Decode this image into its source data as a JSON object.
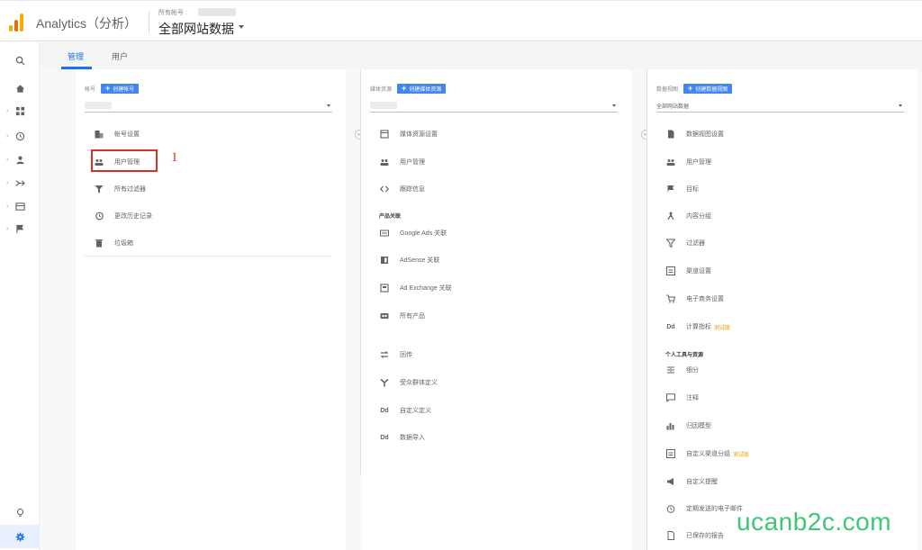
{
  "header": {
    "app_title": "Analytics（分析）",
    "account_label": "所有帐号 :",
    "account_value": "全部网站数据",
    "logo_colors": [
      "#f9ab00",
      "#e37400",
      "#f9ab00"
    ]
  },
  "tabs": [
    {
      "label": "管理",
      "active": true
    },
    {
      "label": "用户",
      "active": false
    }
  ],
  "columns": {
    "account": {
      "label": "帐号",
      "create_label": "创建帐号",
      "items": [
        {
          "icon": "building-icon",
          "label": "帐号设置"
        },
        {
          "icon": "users-icon",
          "label": "用户管理"
        },
        {
          "icon": "filter-icon",
          "label": "所有过滤器"
        },
        {
          "icon": "history-icon",
          "label": "更改历史记录"
        },
        {
          "icon": "trash-icon",
          "label": "垃圾箱"
        }
      ]
    },
    "property": {
      "label": "媒体资源",
      "create_label": "创建媒体资源",
      "items": [
        {
          "icon": "property-settings-icon",
          "label": "媒体资源设置"
        },
        {
          "icon": "users-icon",
          "label": "用户管理"
        },
        {
          "icon": "code-icon",
          "label": "跟踪信息"
        }
      ],
      "product_section_title": "产品关联",
      "product_items": [
        {
          "icon": "google-ads-icon",
          "label": "Google Ads 关联"
        },
        {
          "icon": "adsense-icon",
          "label": "AdSense 关联"
        },
        {
          "icon": "ad-exchange-icon",
          "label": "Ad Exchange 关联"
        },
        {
          "icon": "all-products-icon",
          "label": "所有产品"
        }
      ],
      "other_items": [
        {
          "icon": "postback-icon",
          "label": "回传"
        },
        {
          "icon": "audience-icon",
          "label": "受众群体定义"
        },
        {
          "icon": "custom-definition-icon",
          "label": "自定义定义"
        },
        {
          "icon": "data-import-icon",
          "label": "数据导入"
        }
      ]
    },
    "view": {
      "label": "数据视图",
      "create_label": "创建数据视图",
      "selected": "全部网站数据",
      "items": [
        {
          "icon": "view-settings-icon",
          "label": "数据视图设置"
        },
        {
          "icon": "users-icon",
          "label": "用户管理"
        },
        {
          "icon": "flag-icon",
          "label": "目标"
        },
        {
          "icon": "content-grouping-icon",
          "label": "内容分组"
        },
        {
          "icon": "filter-icon",
          "label": "过滤器"
        },
        {
          "icon": "channel-settings-icon",
          "label": "渠道设置"
        },
        {
          "icon": "cart-icon",
          "label": "电子商务设置"
        },
        {
          "icon": "calculated-metrics-icon",
          "label": "计算指标",
          "beta": "测试版"
        }
      ],
      "personal_section_title": "个人工具与资源",
      "personal_items": [
        {
          "icon": "segments-icon",
          "label": "细分"
        },
        {
          "icon": "annotations-icon",
          "label": "注释"
        },
        {
          "icon": "attribution-icon",
          "label": "归因模型"
        },
        {
          "icon": "custom-channel-icon",
          "label": "自定义渠道分组",
          "beta": "测试版"
        },
        {
          "icon": "custom-alerts-icon",
          "label": "自定义提醒"
        },
        {
          "icon": "scheduled-email-icon",
          "label": "定期发送的电子邮件"
        },
        {
          "icon": "saved-reports-icon",
          "label": "已保存的报告"
        }
      ]
    }
  },
  "annotation": {
    "number": "1",
    "color": "#d93025"
  },
  "watermark": "ucanb2c.com",
  "accent_color": "#4285f4"
}
